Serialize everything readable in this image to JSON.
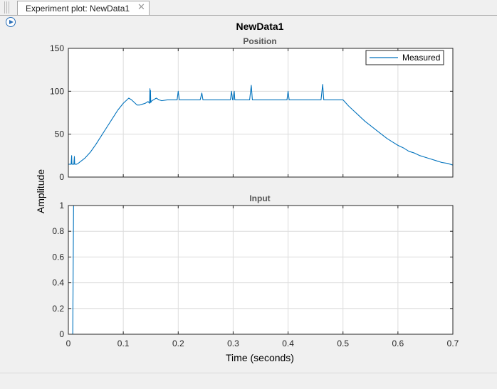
{
  "tab": {
    "label": "Experiment plot: NewData1",
    "close_icon": "close-icon",
    "grip_icon": "drag-handle-icon"
  },
  "toolbar": {
    "expand_icon": "play-arrow-icon"
  },
  "chart_data": [
    {
      "type": "line",
      "figure_title": "NewData1",
      "title": "Position",
      "ylabel": "Amplitude",
      "xlabel": "Time (seconds)",
      "xlim": [
        0,
        0.7
      ],
      "ylim": [
        0,
        150
      ],
      "xticks": [
        0,
        0.1,
        0.2,
        0.3,
        0.4,
        0.5,
        0.6,
        0.7
      ],
      "yticks": [
        0,
        50,
        100,
        150
      ],
      "grid": true,
      "legend": {
        "placement": "top-right",
        "entries": [
          "Measured"
        ]
      },
      "series": [
        {
          "name": "Measured",
          "color": "#0072bd",
          "x": [
            0,
            0.005,
            0.006,
            0.0065,
            0.007,
            0.0085,
            0.01,
            0.011,
            0.0115,
            0.012,
            0.013,
            0.015,
            0.018,
            0.02,
            0.03,
            0.04,
            0.05,
            0.06,
            0.07,
            0.08,
            0.09,
            0.1,
            0.11,
            0.115,
            0.12,
            0.125,
            0.13,
            0.135,
            0.14,
            0.145,
            0.148,
            0.1485,
            0.149,
            0.1495,
            0.15,
            0.152,
            0.155,
            0.16,
            0.165,
            0.17,
            0.18,
            0.19,
            0.198,
            0.2,
            0.202,
            0.21,
            0.22,
            0.23,
            0.24,
            0.243,
            0.245,
            0.247,
            0.26,
            0.27,
            0.28,
            0.29,
            0.295,
            0.297,
            0.299,
            0.3,
            0.302,
            0.303,
            0.305,
            0.307,
            0.31,
            0.32,
            0.33,
            0.333,
            0.335,
            0.337,
            0.35,
            0.36,
            0.37,
            0.38,
            0.39,
            0.398,
            0.4,
            0.402,
            0.41,
            0.42,
            0.43,
            0.44,
            0.45,
            0.46,
            0.463,
            0.465,
            0.467,
            0.47,
            0.48,
            0.49,
            0.5,
            0.51,
            0.52,
            0.53,
            0.54,
            0.55,
            0.56,
            0.57,
            0.58,
            0.59,
            0.6,
            0.61,
            0.62,
            0.63,
            0.64,
            0.65,
            0.66,
            0.67,
            0.68,
            0.69,
            0.7
          ],
          "y": [
            15,
            15,
            25,
            15,
            15,
            15,
            15,
            24,
            15,
            15,
            15,
            15,
            16,
            17,
            22,
            29,
            38,
            48,
            58,
            68,
            78,
            86,
            92,
            90,
            87,
            84,
            84,
            85,
            86,
            88,
            86,
            103,
            87,
            101,
            87,
            89,
            90,
            92,
            90,
            89,
            90,
            90,
            90,
            100,
            90,
            90,
            90,
            90,
            90,
            98,
            90,
            90,
            90,
            90,
            90,
            90,
            90,
            100,
            90,
            90,
            100,
            90,
            90,
            90,
            90,
            90,
            90,
            107,
            90,
            90,
            90,
            90,
            90,
            90,
            90,
            90,
            100,
            90,
            90,
            90,
            90,
            90,
            90,
            90,
            108,
            90,
            90,
            90,
            90,
            90,
            90,
            83,
            77,
            71,
            65,
            60,
            55,
            50,
            45,
            41,
            37,
            34,
            30,
            28,
            25,
            23,
            21,
            19,
            17,
            16,
            14
          ]
        }
      ]
    },
    {
      "type": "line",
      "title": "Input",
      "xlim": [
        0,
        0.7
      ],
      "ylim": [
        0,
        1
      ],
      "xticks": [
        0,
        0.1,
        0.2,
        0.3,
        0.4,
        0.5,
        0.6,
        0.7
      ],
      "xtick_labels": [
        "0",
        "0.1",
        "0.2",
        "0.3",
        "0.4",
        "0.5",
        "0.6",
        "0.7"
      ],
      "yticks": [
        0,
        0.2,
        0.4,
        0.6,
        0.8,
        1
      ],
      "ytick_labels": [
        "0",
        "0.2",
        "0.4",
        "0.6",
        "0.8",
        "1"
      ],
      "grid": true,
      "series": [
        {
          "color": "#0072bd",
          "x": [
            0,
            0.008,
            0.0095,
            0.7
          ],
          "y": [
            0,
            0,
            1,
            1
          ]
        }
      ]
    }
  ]
}
